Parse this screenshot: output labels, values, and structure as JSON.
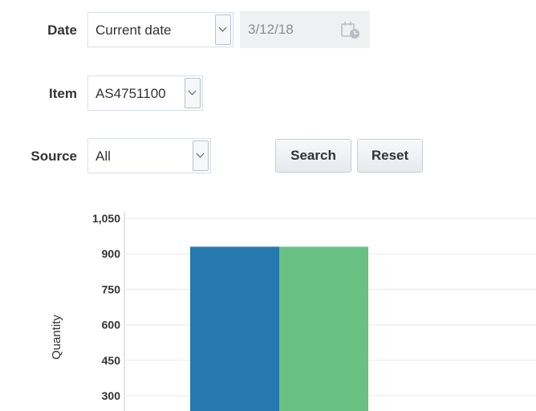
{
  "form": {
    "date": {
      "label": "Date",
      "selected": "Current date",
      "value": "3/12/18"
    },
    "item": {
      "label": "Item",
      "selected": "AS4751100"
    },
    "source": {
      "label": "Source",
      "selected": "All"
    },
    "search_label": "Search",
    "reset_label": "Reset"
  },
  "colors": {
    "series1": "#2679ae",
    "series2": "#68c182"
  },
  "chart_data": {
    "type": "bar",
    "ylabel": "Quantity",
    "ylim": [
      0,
      1050
    ],
    "yticks": [
      "1,050",
      "900",
      "750",
      "600",
      "450",
      "300"
    ],
    "series": [
      {
        "values": [
          930
        ]
      },
      {
        "values": [
          930
        ]
      }
    ],
    "grid": true
  }
}
